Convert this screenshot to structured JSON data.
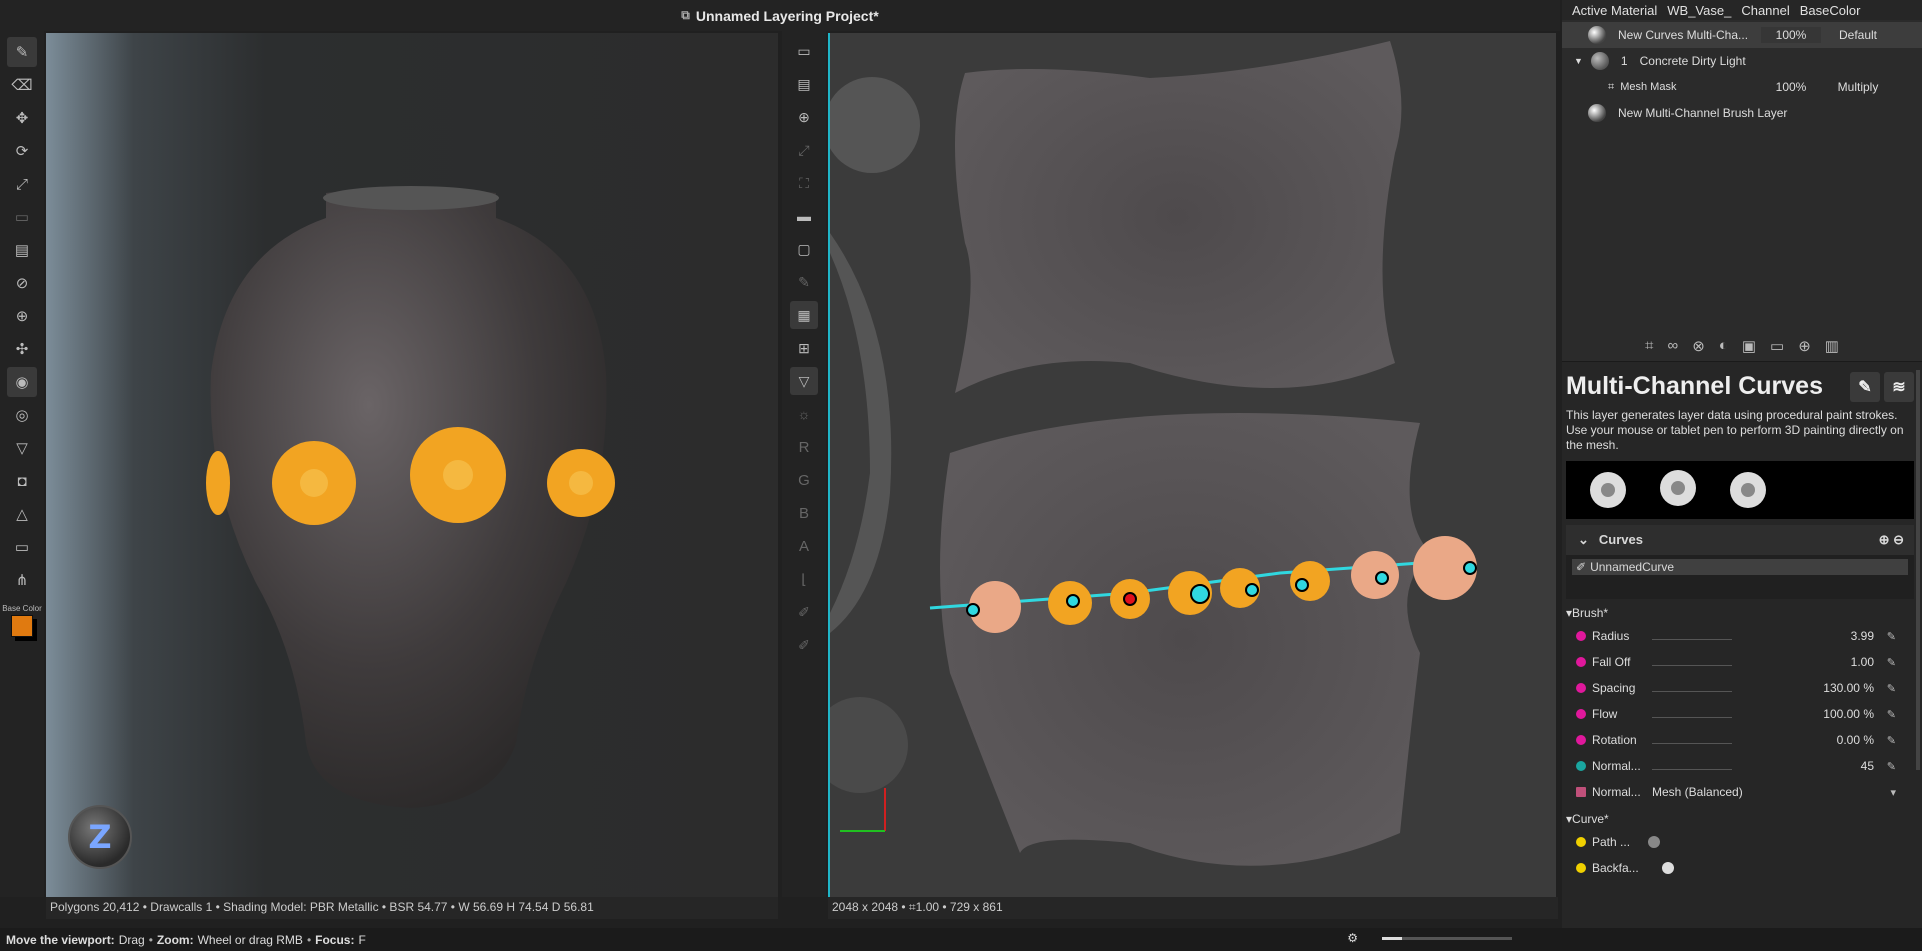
{
  "titlebar": {
    "title": "Unnamed Layering Project*",
    "icon": "project-icon"
  },
  "left_toolbar": {
    "tools": [
      "brush-icon",
      "eraser-icon",
      "move-icon",
      "rotate-icon",
      "scale-icon",
      "save-icon",
      "clipboard-icon",
      "hide-icon",
      "target-icon",
      "transform-icon",
      "isolate-icon",
      "visibility-icon",
      "filter-icon",
      "camera-icon",
      "triangle-icon",
      "display-icon",
      "hierarchy-icon"
    ],
    "base_color_label": "Base Color",
    "base_color": "#e07a10"
  },
  "viewport3d": {
    "gizmo_label": "Z",
    "stats": "Polygons 20,412 • Drawcalls 1 • Shading Model: PBR Metallic • BSR 54.77 • W 56.69 H 74.54 D 56.81"
  },
  "mid_toolbar": {
    "letters": [
      "R",
      "G",
      "B",
      "A"
    ]
  },
  "viewport2d": {
    "stats": "2048 x 2048 • ⌗1.00 • 729 x 861"
  },
  "statusbar": {
    "move_label": "Move the viewport:",
    "move_hint": "Drag",
    "zoom_label": "Zoom:",
    "zoom_hint": "Wheel or drag RMB",
    "focus_label": "Focus:",
    "focus_hint": "F",
    "zoom_level": 0.15
  },
  "right_panel": {
    "header": {
      "active_material_label": "Active Material",
      "material": "WB_Vase_",
      "channel_label": "Channel",
      "channel": "BaseColor"
    },
    "layers": [
      {
        "name": "New Curves Multi-Cha...",
        "opacity": "100%",
        "blend": "Default"
      },
      {
        "index": "1",
        "name": "Concrete Dirty Light"
      },
      {
        "name": "Mesh Mask",
        "opacity": "100%",
        "blend": "Multiply"
      },
      {
        "name": "New Multi-Channel Brush Layer"
      }
    ],
    "title": "Multi-Channel Curves",
    "description": "This layer generates layer data using procedural paint strokes. Use your mouse or tablet pen to perform 3D painting directly on the mesh.",
    "curves_label": "Curves",
    "curve_name": "UnnamedCurve",
    "brush_section": "Brush*",
    "brush_props": [
      {
        "name": "Radius",
        "value": "3.99",
        "color": "#e0189c"
      },
      {
        "name": "Fall Off",
        "value": "1.00",
        "color": "#e0189c"
      },
      {
        "name": "Spacing",
        "value": "130.00 %",
        "color": "#e0189c"
      },
      {
        "name": "Flow",
        "value": "100.00 %",
        "color": "#e0189c"
      },
      {
        "name": "Rotation",
        "value": "0.00 %",
        "color": "#e0189c"
      },
      {
        "name": "Normal...",
        "value": "45",
        "color": "#1aa6a0"
      }
    ],
    "normal_mode": {
      "name": "Normal...",
      "value": "Mesh (Balanced)"
    },
    "curve_section": "Curve*",
    "curve_props": [
      {
        "name": "Path ..."
      },
      {
        "name": "Backfa..."
      }
    ]
  }
}
